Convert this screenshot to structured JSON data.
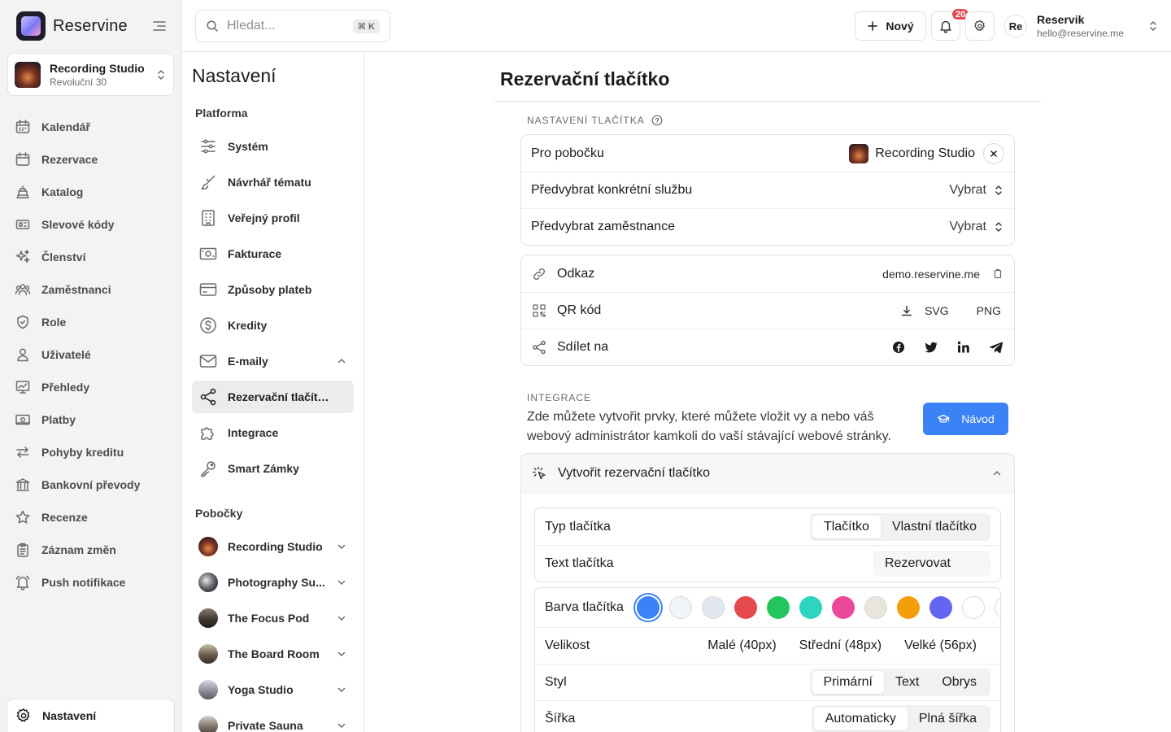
{
  "app": {
    "name": "Reservine"
  },
  "branch_selector": {
    "name": "Recording Studio",
    "address": "Revoluční 30"
  },
  "sidebar": {
    "items": [
      {
        "label": "Kalendář",
        "icon": "calendar-icon"
      },
      {
        "label": "Rezervace",
        "icon": "calendar-check-icon"
      },
      {
        "label": "Katalog",
        "icon": "catalog-icon"
      },
      {
        "label": "Slevové kódy",
        "icon": "ticket-icon"
      },
      {
        "label": "Členství",
        "icon": "sparkles-icon"
      },
      {
        "label": "Zaměstnanci",
        "icon": "users-icon"
      },
      {
        "label": "Role",
        "icon": "shield-icon"
      },
      {
        "label": "Uživatelé",
        "icon": "user-icon"
      },
      {
        "label": "Přehledy",
        "icon": "chart-icon"
      },
      {
        "label": "Platby",
        "icon": "banknote-icon"
      },
      {
        "label": "Pohyby kreditu",
        "icon": "arrows-icon"
      },
      {
        "label": "Bankovní převody",
        "icon": "bank-icon"
      },
      {
        "label": "Recenze",
        "icon": "star-icon"
      },
      {
        "label": "Záznam změn",
        "icon": "clipboard-icon"
      },
      {
        "label": "Push notifikace",
        "icon": "bell-ring-icon"
      }
    ],
    "settings_label": "Nastavení"
  },
  "topbar": {
    "search_placeholder": "Hledat...",
    "search_shortcut": "⌘ K",
    "new_label": "Nový",
    "notification_count": "20",
    "user": {
      "initials": "Re",
      "name": "Reservik",
      "email": "hello@reservine.me"
    }
  },
  "settings_nav": {
    "title": "Nastavení",
    "platform_heading": "Platforma",
    "platform_items": [
      {
        "label": "Systém",
        "icon": "sliders-icon"
      },
      {
        "label": "Návrhář tématu",
        "icon": "brush-icon"
      },
      {
        "label": "Veřejný profil",
        "icon": "building-icon"
      },
      {
        "label": "Fakturace",
        "icon": "invoice-icon"
      },
      {
        "label": "Způsoby plateb",
        "icon": "credit-card-icon"
      },
      {
        "label": "Kredity",
        "icon": "dollar-circle-icon"
      },
      {
        "label": "E-maily",
        "icon": "mail-icon"
      },
      {
        "label": "Rezervační tlačítko",
        "icon": "share-icon"
      },
      {
        "label": "Integrace",
        "icon": "puzzle-icon"
      },
      {
        "label": "Smart Zámky",
        "icon": "key-icon"
      }
    ],
    "branches_heading": "Pobočky",
    "branches": [
      {
        "label": "Recording Studio",
        "color": "#7a3422"
      },
      {
        "label": "Photography Su...",
        "color": "#3a3a40"
      },
      {
        "label": "The Focus Pod",
        "color": "#5a5048"
      },
      {
        "label": "The Board Room",
        "color": "#6b5a4a"
      },
      {
        "label": "Yoga Studio",
        "color": "#8a8a92"
      },
      {
        "label": "Private Sauna",
        "color": "#7d7368"
      }
    ]
  },
  "main": {
    "title": "Rezervační tlačítko",
    "button_settings": {
      "section_label": "NASTAVENÍ TLAČÍTKA",
      "branch_label": "Pro pobočku",
      "branch_value": "Recording Studio",
      "service_label": "Předvybrat konkrétní službu",
      "service_value": "Vybrat",
      "employee_label": "Předvybrat zaměstnance",
      "employee_value": "Vybrat"
    },
    "links": {
      "link_label": "Odkaz",
      "link_value": "demo.reservine.me",
      "qr_label": "QR kód",
      "qr_svg": "SVG",
      "qr_png": "PNG",
      "share_label": "Sdílet na"
    },
    "integration": {
      "section_label": "INTEGRACE",
      "description": "Zde můžete vytvořit prvky, které můžete vložit vy a nebo váš webový administrátor kamkoli do vaší stávající webové stránky.",
      "guide_label": "Návod",
      "accordion_title": "Vytvořit rezervační tlačítko",
      "type_label": "Typ tlačítka",
      "type_options": [
        "Tlačítko",
        "Vlastní tlačítko"
      ],
      "text_label": "Text tlačítka",
      "text_value": "Rezervovat",
      "color_label": "Barva tlačítka",
      "colors": [
        "#3b82f6",
        "#f1f5f9",
        "#e2e8f0",
        "#e5484d",
        "#22c55e",
        "#2dd4bf",
        "#ec4899",
        "#e7e5dc",
        "#f59e0b",
        "#6366f1",
        "#ffffff",
        "#ffffff"
      ],
      "size_label": "Velikost",
      "size_options": [
        "Malé (40px)",
        "Střední (48px)",
        "Velké (56px)"
      ],
      "style_label": "Styl",
      "style_options": [
        "Primární",
        "Text",
        "Obrys"
      ],
      "width_label": "Šířka",
      "width_options": [
        "Automaticky",
        "Plná šířka"
      ]
    }
  }
}
